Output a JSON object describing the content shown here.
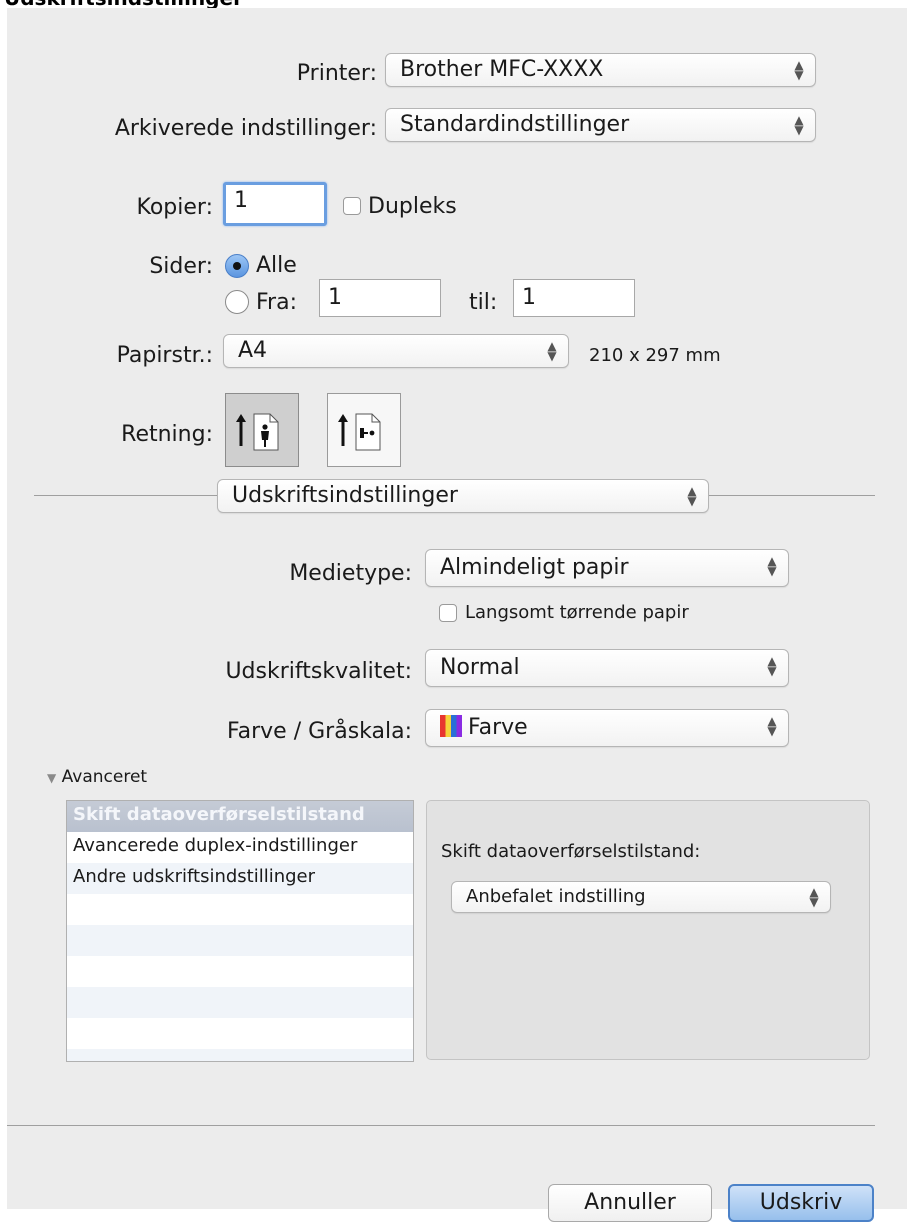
{
  "heading": "Udskriftsindstillinger",
  "printer": {
    "label": "Printer:",
    "value": "Brother MFC-XXXX"
  },
  "presets": {
    "label": "Arkiverede indstillinger:",
    "value": "Standardindstillinger"
  },
  "copies": {
    "label": "Kopier:",
    "value": "1",
    "duplex_label": "Dupleks"
  },
  "pages": {
    "label": "Sider:",
    "all_label": "Alle",
    "from_label": "Fra:",
    "from_value": "1",
    "to_label": "til:",
    "to_value": "1"
  },
  "paper_size": {
    "label": "Papirstr.:",
    "value": "A4",
    "dimensions": "210 x 297 mm"
  },
  "orientation": {
    "label": "Retning:",
    "selected": "portrait"
  },
  "section_popup": {
    "value": "Udskriftsindstillinger"
  },
  "media_type": {
    "label": "Medietype:",
    "value": "Almindeligt papir",
    "slow_dry_label": "Langsomt tørrende papir"
  },
  "quality": {
    "label": "Udskriftskvalitet:",
    "value": "Normal"
  },
  "color": {
    "label": "Farve / Gråskala:",
    "value": "Farve",
    "swatch_colors": [
      "#e8352f",
      "#f5d23a",
      "#2a6fd6",
      "#8a2be2"
    ]
  },
  "advanced": {
    "label": "Avanceret",
    "items": [
      "Skift dataoverførselstilstand",
      "Avancerede duplex-indstillinger",
      "Andre udskriftsindstillinger"
    ],
    "selected_index": 0,
    "panel_title": "Skift dataoverførselstilstand:",
    "panel_value": "Anbefalet indstilling"
  },
  "buttons": {
    "cancel": "Annuller",
    "print": "Udskriv"
  },
  "colors": {
    "accent": "#5b95e0",
    "dialog_bg": "#ececec"
  }
}
